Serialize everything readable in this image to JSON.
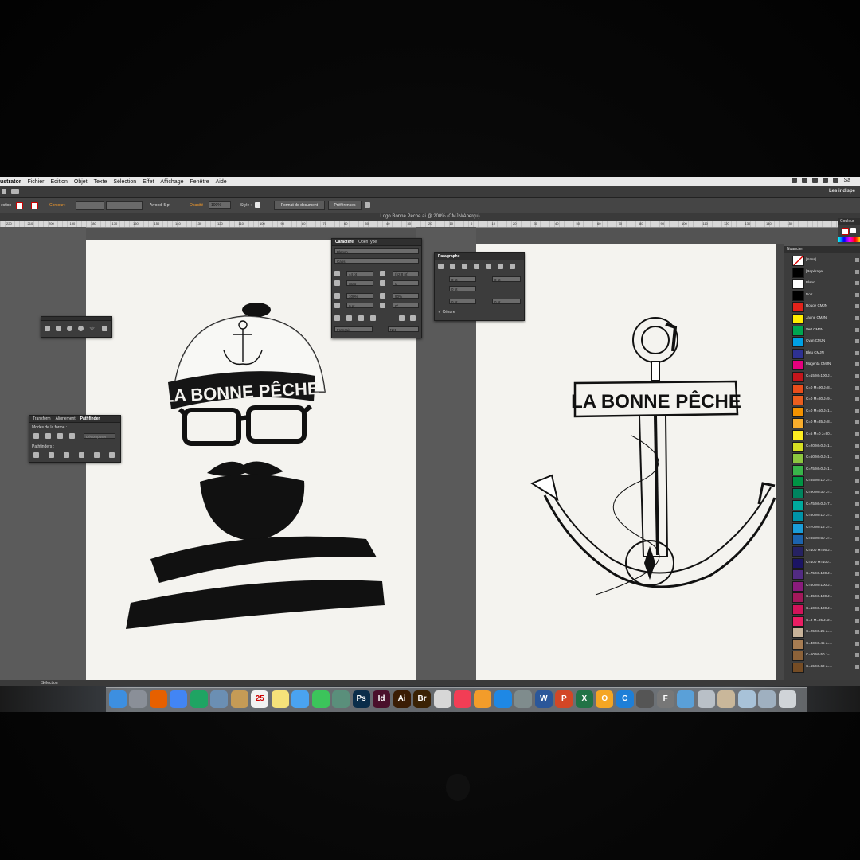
{
  "menubar": {
    "app_name": "ustrator",
    "items": [
      "Fichier",
      "Edition",
      "Objet",
      "Texte",
      "Sélection",
      "Effet",
      "Affichage",
      "Fenêtre",
      "Aide"
    ],
    "right_text": "Sa"
  },
  "topbar": {
    "workspace": "Les indispe"
  },
  "control_bar": {
    "selection_label": "ection",
    "contour_label": "Contour :",
    "stroke_profile": "Arrondi 5 pt",
    "opacity_label": "Opacité",
    "opacity_value": "100%",
    "style_label": "Style :",
    "doc_format_button": "Format de document",
    "preferences_button": "Préférences"
  },
  "document": {
    "title": "Logo Bonne Peche.ai @ 200% (CMJN/Aperçu)"
  },
  "ruler": {
    "labels": [
      "220",
      "210",
      "200",
      "190",
      "180",
      "170",
      "160",
      "150",
      "140",
      "130",
      "120",
      "110",
      "100",
      "90",
      "80",
      "70",
      "60",
      "50",
      "40",
      "30",
      "20",
      "10",
      "0",
      "10",
      "20",
      "30",
      "40",
      "50",
      "60",
      "70",
      "80",
      "90",
      "100",
      "110",
      "120",
      "130",
      "140",
      "150"
    ]
  },
  "artwork": {
    "logo_text_left": "LA BONNE PÊCHE",
    "logo_text_right": "LA BONNE PÊCHE"
  },
  "character_panel": {
    "tab_active": "Caractère",
    "tab_other": "OpenType",
    "font_family": "Blanch",
    "font_style": "Caps",
    "font_size": "44 pt",
    "leading": "(52,8 pt)",
    "kerning": "Auto",
    "tracking": "0",
    "vscale": "100%",
    "hscale": "90%",
    "baseline": "0 pt",
    "rotation": "0°",
    "language": "Français",
    "antialias": "Net"
  },
  "paragraph_panel": {
    "tab": "Paragraphe",
    "indent_left": "0 pt",
    "indent_right": "0 pt",
    "first_indent": "0 pt",
    "space_before": "0 pt",
    "space_after": "0 pt",
    "hyphenation": "Césure"
  },
  "pathfinder_panel": {
    "tabs": [
      "Transform",
      "Alignement",
      "Pathfinder"
    ],
    "shape_modes_label": "Modes de la forme :",
    "expand_button": "Décomposer",
    "pathfinders_label": "Pathfinders :"
  },
  "swatches_panel": {
    "title": "Nuancier",
    "color_panel_title": "Couleur",
    "swatches": [
      {
        "name": "[Sans]",
        "color": "#ffffff",
        "none": true
      },
      {
        "name": "[Repérage]",
        "color": "#000000"
      },
      {
        "name": "Blanc",
        "color": "#ffffff"
      },
      {
        "name": "Noir",
        "color": "#000000"
      },
      {
        "name": "Rouge CMJN",
        "color": "#e2231a"
      },
      {
        "name": "Jaune CMJN",
        "color": "#ffed00"
      },
      {
        "name": "Vert CMJN",
        "color": "#00a651"
      },
      {
        "name": "Cyan CMJN",
        "color": "#00a0e3"
      },
      {
        "name": "Bleu CMJN",
        "color": "#2e3192"
      },
      {
        "name": "Magenta CMJN",
        "color": "#e6007e"
      },
      {
        "name": "C=15 M=100 J...",
        "color": "#c4161c"
      },
      {
        "name": "C=0 M=90 J=8...",
        "color": "#e94e1b"
      },
      {
        "name": "C=0 M=80 J=9...",
        "color": "#eb5e1e"
      },
      {
        "name": "C=0 M=50 J=1...",
        "color": "#f39200"
      },
      {
        "name": "C=0 M=35 J=8...",
        "color": "#f8ad2c"
      },
      {
        "name": "C=5 M=0 J=90...",
        "color": "#fdee21"
      },
      {
        "name": "C=20 M=0 J=1...",
        "color": "#d7df23"
      },
      {
        "name": "C=50 M=0 J=1...",
        "color": "#8dc63f"
      },
      {
        "name": "C=75 M=0 J=1...",
        "color": "#39b54a"
      },
      {
        "name": "C=85 M=10 J=...",
        "color": "#009444"
      },
      {
        "name": "C=90 M=30 J=...",
        "color": "#00855f"
      },
      {
        "name": "C=75 M=0 J=7...",
        "color": "#00a99d"
      },
      {
        "name": "C=80 M=10 J=...",
        "color": "#0093a8"
      },
      {
        "name": "C=70 M=15 J=...",
        "color": "#1b9dd9"
      },
      {
        "name": "C=85 M=50 J=...",
        "color": "#1c63ad"
      },
      {
        "name": "C=100 M=95 J...",
        "color": "#262262"
      },
      {
        "name": "C=100 M=100...",
        "color": "#1b1464"
      },
      {
        "name": "C=75 M=100 J...",
        "color": "#522b83"
      },
      {
        "name": "C=50 M=100 J...",
        "color": "#8a1c7c"
      },
      {
        "name": "C=35 M=100 J...",
        "color": "#a3195b"
      },
      {
        "name": "C=10 M=100 J...",
        "color": "#d1145a"
      },
      {
        "name": "C=0 M=95 J=2...",
        "color": "#e91e63"
      },
      {
        "name": "C=25 M=25 J=...",
        "color": "#c7b299"
      },
      {
        "name": "C=40 M=45 J=...",
        "color": "#a67c52"
      },
      {
        "name": "C=50 M=50 J=...",
        "color": "#8c6239"
      },
      {
        "name": "C=55 M=60 J=...",
        "color": "#754c24"
      }
    ]
  },
  "status": {
    "tool": "Sélection"
  },
  "dock": {
    "apps": [
      {
        "label": "",
        "color": "#3d8fe0",
        "name": "finder-icon"
      },
      {
        "label": "",
        "color": "#8a8f98",
        "name": "launchpad-icon"
      },
      {
        "label": "",
        "color": "#e66000",
        "name": "firefox-icon"
      },
      {
        "label": "",
        "color": "#4285f4",
        "name": "chrome-icon"
      },
      {
        "label": "",
        "color": "#1fa463",
        "name": "drive-icon"
      },
      {
        "label": "",
        "color": "#6b8fb3",
        "name": "preview-icon"
      },
      {
        "label": "",
        "color": "#c59b56",
        "name": "contacts-icon"
      },
      {
        "label": "25",
        "color": "#f2f2f2",
        "name": "calendar-icon"
      },
      {
        "label": "",
        "color": "#f5e27a",
        "name": "notes-icon"
      },
      {
        "label": "",
        "color": "#4aa3f0",
        "name": "messages-icon"
      },
      {
        "label": "",
        "color": "#3cc45b",
        "name": "facetime-icon"
      },
      {
        "label": "",
        "color": "#5a8f7b",
        "name": "photos-icon"
      },
      {
        "label": "Ps",
        "color": "#0b2d4a",
        "name": "photoshop-icon"
      },
      {
        "label": "Id",
        "color": "#4a0f2b",
        "name": "indesign-icon"
      },
      {
        "label": "Ai",
        "color": "#3a1c04",
        "name": "illustrator-icon"
      },
      {
        "label": "Br",
        "color": "#3a2204",
        "name": "bridge-icon"
      },
      {
        "label": "",
        "color": "#d7d7d7",
        "name": "acrobat-icon"
      },
      {
        "label": "",
        "color": "#f23d55",
        "name": "music-icon"
      },
      {
        "label": "",
        "color": "#f39c2a",
        "name": "books-icon"
      },
      {
        "label": "",
        "color": "#1e88e5",
        "name": "appstore-icon"
      },
      {
        "label": "",
        "color": "#7f8c8d",
        "name": "calculator-icon"
      },
      {
        "label": "W",
        "color": "#2b579a",
        "name": "word-icon"
      },
      {
        "label": "P",
        "color": "#d24726",
        "name": "powerpoint-icon"
      },
      {
        "label": "X",
        "color": "#217346",
        "name": "excel-icon"
      },
      {
        "label": "O",
        "color": "#f5a623",
        "name": "outlook-icon"
      },
      {
        "label": "C",
        "color": "#1e7fd8",
        "name": "cloud-icon"
      },
      {
        "label": "",
        "color": "#555555",
        "name": "utility-icon"
      },
      {
        "label": "F",
        "color": "#777777",
        "name": "font-icon"
      },
      {
        "label": "",
        "color": "#5aa0d8",
        "name": "folder-icon"
      },
      {
        "label": "",
        "color": "#b9c0c7",
        "name": "stack-icon-1"
      },
      {
        "label": "",
        "color": "#c9b79a",
        "name": "stack-icon-2"
      },
      {
        "label": "",
        "color": "#a8c2d8",
        "name": "stack-icon-3"
      },
      {
        "label": "",
        "color": "#9fb0c0",
        "name": "stack-icon-4"
      },
      {
        "label": "",
        "color": "#d0d4d8",
        "name": "trash-icon"
      }
    ]
  }
}
